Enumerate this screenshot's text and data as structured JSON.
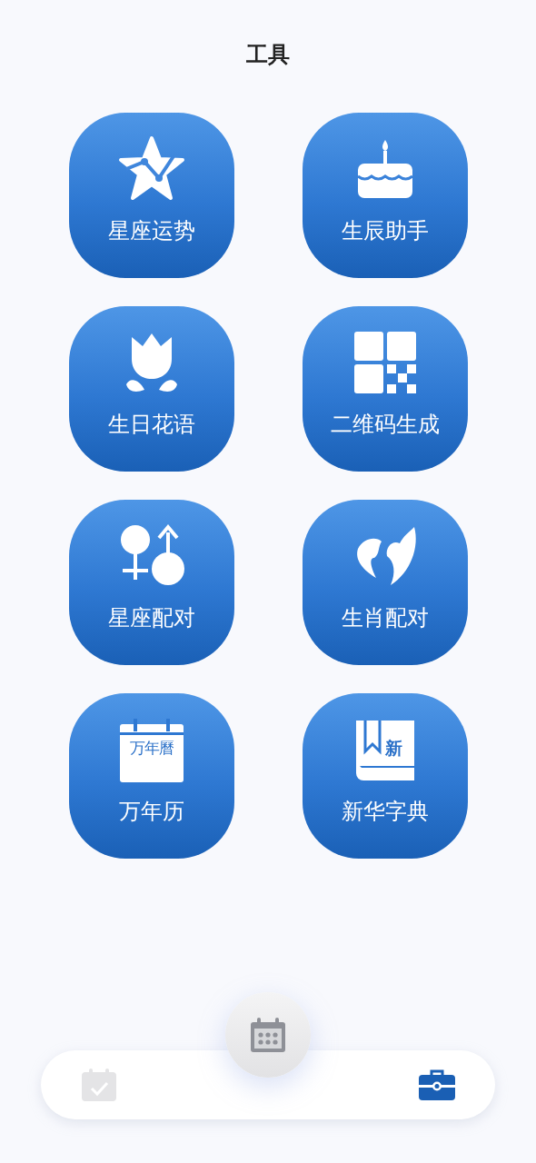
{
  "title": "工具",
  "tools": [
    {
      "label": "星座运势",
      "kind": "star"
    },
    {
      "label": "生辰助手",
      "kind": "cake"
    },
    {
      "label": "生日花语",
      "kind": "flower"
    },
    {
      "label": "二维码生成",
      "kind": "qr"
    },
    {
      "label": "星座配对",
      "kind": "pair"
    },
    {
      "label": "生肖配对",
      "kind": "zodiac"
    },
    {
      "label": "万年历",
      "kind": "calendar",
      "icon_text": "万年曆"
    },
    {
      "label": "新华字典",
      "kind": "book",
      "icon_text": "新"
    }
  ],
  "nav": [
    {
      "kind": "check",
      "selected": false
    },
    {
      "kind": "fab",
      "selected": false
    },
    {
      "kind": "briefcase",
      "selected": true
    }
  ]
}
